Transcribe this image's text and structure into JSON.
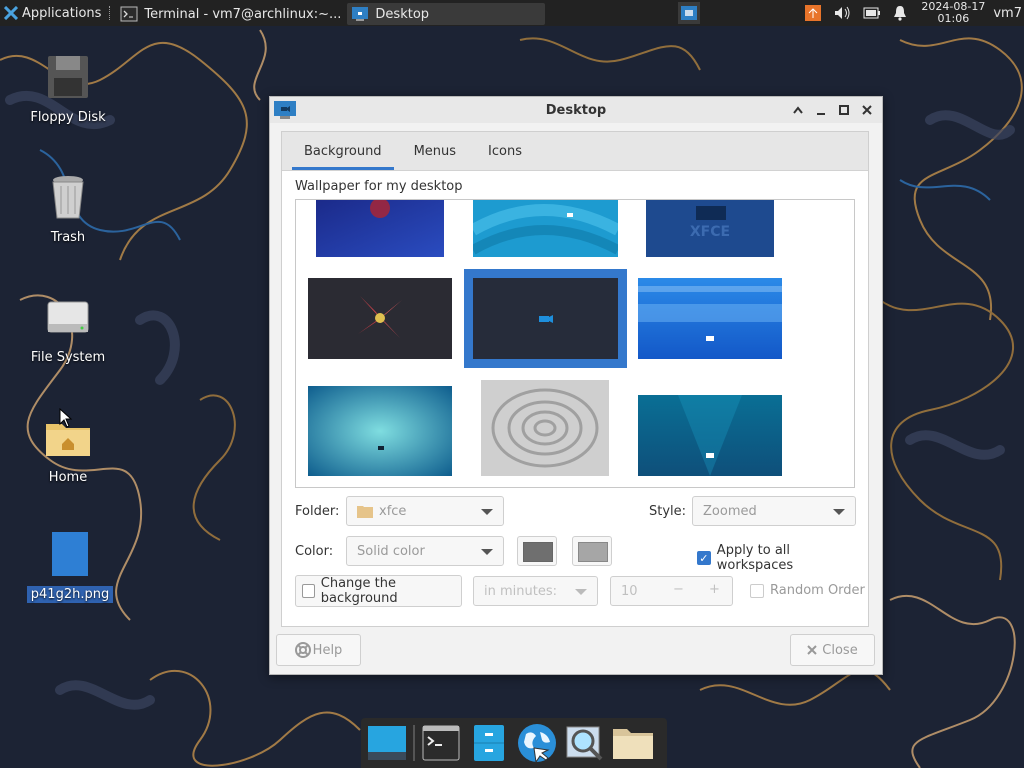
{
  "panel": {
    "applications_label": "Applications",
    "tasks": [
      {
        "label": "Terminal - vm7@archlinux:~...",
        "icon": "terminal-icon"
      },
      {
        "label": "Desktop",
        "icon": "desktop-settings-icon"
      }
    ],
    "clock": {
      "date": "2024-08-17",
      "time": "01:06"
    },
    "user": "vm7",
    "tray_icons": [
      "update-notifier-icon",
      "volume-icon",
      "battery-icon",
      "notification-bell-icon"
    ]
  },
  "desktop_icons": [
    {
      "label": "Floppy Disk",
      "icon": "floppy-disk-icon"
    },
    {
      "label": "Trash",
      "icon": "trash-icon"
    },
    {
      "label": "File System",
      "icon": "hard-drive-icon"
    },
    {
      "label": "Home",
      "icon": "home-folder-icon"
    },
    {
      "label": "p41g2h.png",
      "icon": "image-file-icon"
    }
  ],
  "dialog": {
    "title": "Desktop",
    "tabs": [
      {
        "label": "Background",
        "active": true
      },
      {
        "label": "Menus",
        "active": false
      },
      {
        "label": "Icons",
        "active": false
      }
    ],
    "wallpaper_label": "Wallpaper for my desktop",
    "wallpapers": [
      {
        "name": "blue-red-wallpaper"
      },
      {
        "name": "cyan-swirl-wallpaper"
      },
      {
        "name": "xfce-logo-wallpaper"
      },
      {
        "name": "dark-flower-wallpaper"
      },
      {
        "name": "dark-mouse-wallpaper",
        "selected": true
      },
      {
        "name": "blue-stripes-wallpaper"
      },
      {
        "name": "teal-gradient-wallpaper"
      },
      {
        "name": "grey-ripple-wallpaper"
      },
      {
        "name": "teal-rays-wallpaper"
      }
    ],
    "folder_label": "Folder:",
    "folder_value": "xfce",
    "style_label": "Style:",
    "style_value": "Zoomed",
    "color_label": "Color:",
    "color_value": "Solid color",
    "primary_color": "#6f6f6f",
    "secondary_color": "#a6a6a6",
    "apply_all_label": "Apply to all workspaces",
    "apply_all_checked": true,
    "change_bg_label": "Change the background",
    "change_bg_checked": false,
    "interval_unit": "in minutes:",
    "interval_value": "10",
    "random_order_label": "Random Order",
    "help_label": "Help",
    "close_label": "Close"
  }
}
